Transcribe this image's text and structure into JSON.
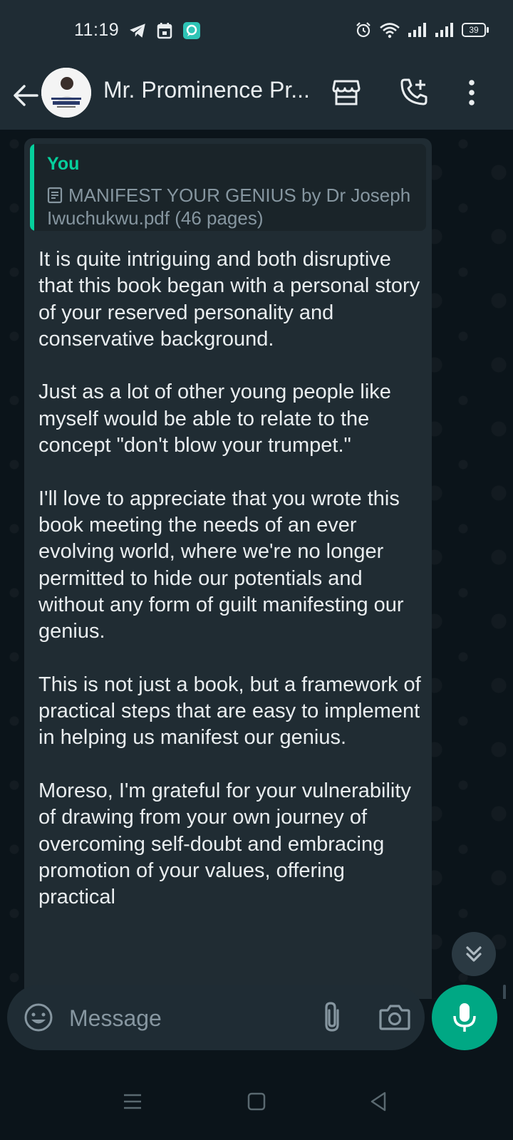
{
  "status_bar": {
    "time": "11:19",
    "battery": "39"
  },
  "header": {
    "contact_name": "Mr. Prominence Pr...",
    "avatar_text": "PROMINENCE PROMISE"
  },
  "message": {
    "quote": {
      "sender": "You",
      "file_label": "MANIFEST YOUR GENIUS by Dr Joseph Iwuchukwu.pdf (46 pages)"
    },
    "text": "It is quite intriguing and both disruptive that this book began with a personal story of your reserved personality and conservative background.\n\nJust as a lot of other young people like myself would be able to relate to the concept \"don't blow your trumpet.\"\n\nI'll love to appreciate that you wrote this book meeting the needs of an ever evolving world, where we're no longer permitted to hide our potentials and without any form of guilt manifesting our genius.\n\nThis is not just a book, but a framework of practical steps that are easy to implement in helping us manifest our genius.\n\nMoreso, I'm grateful for your vulnerability of drawing from your own journey of overcoming self-doubt and embracing promotion of your values, offering practical"
  },
  "composer": {
    "placeholder": "Message"
  },
  "colors": {
    "accent": "#00a884",
    "quote_accent": "#06cf9c",
    "bubble": "#202c33",
    "header": "#1f2c34",
    "background": "#0b141a"
  }
}
